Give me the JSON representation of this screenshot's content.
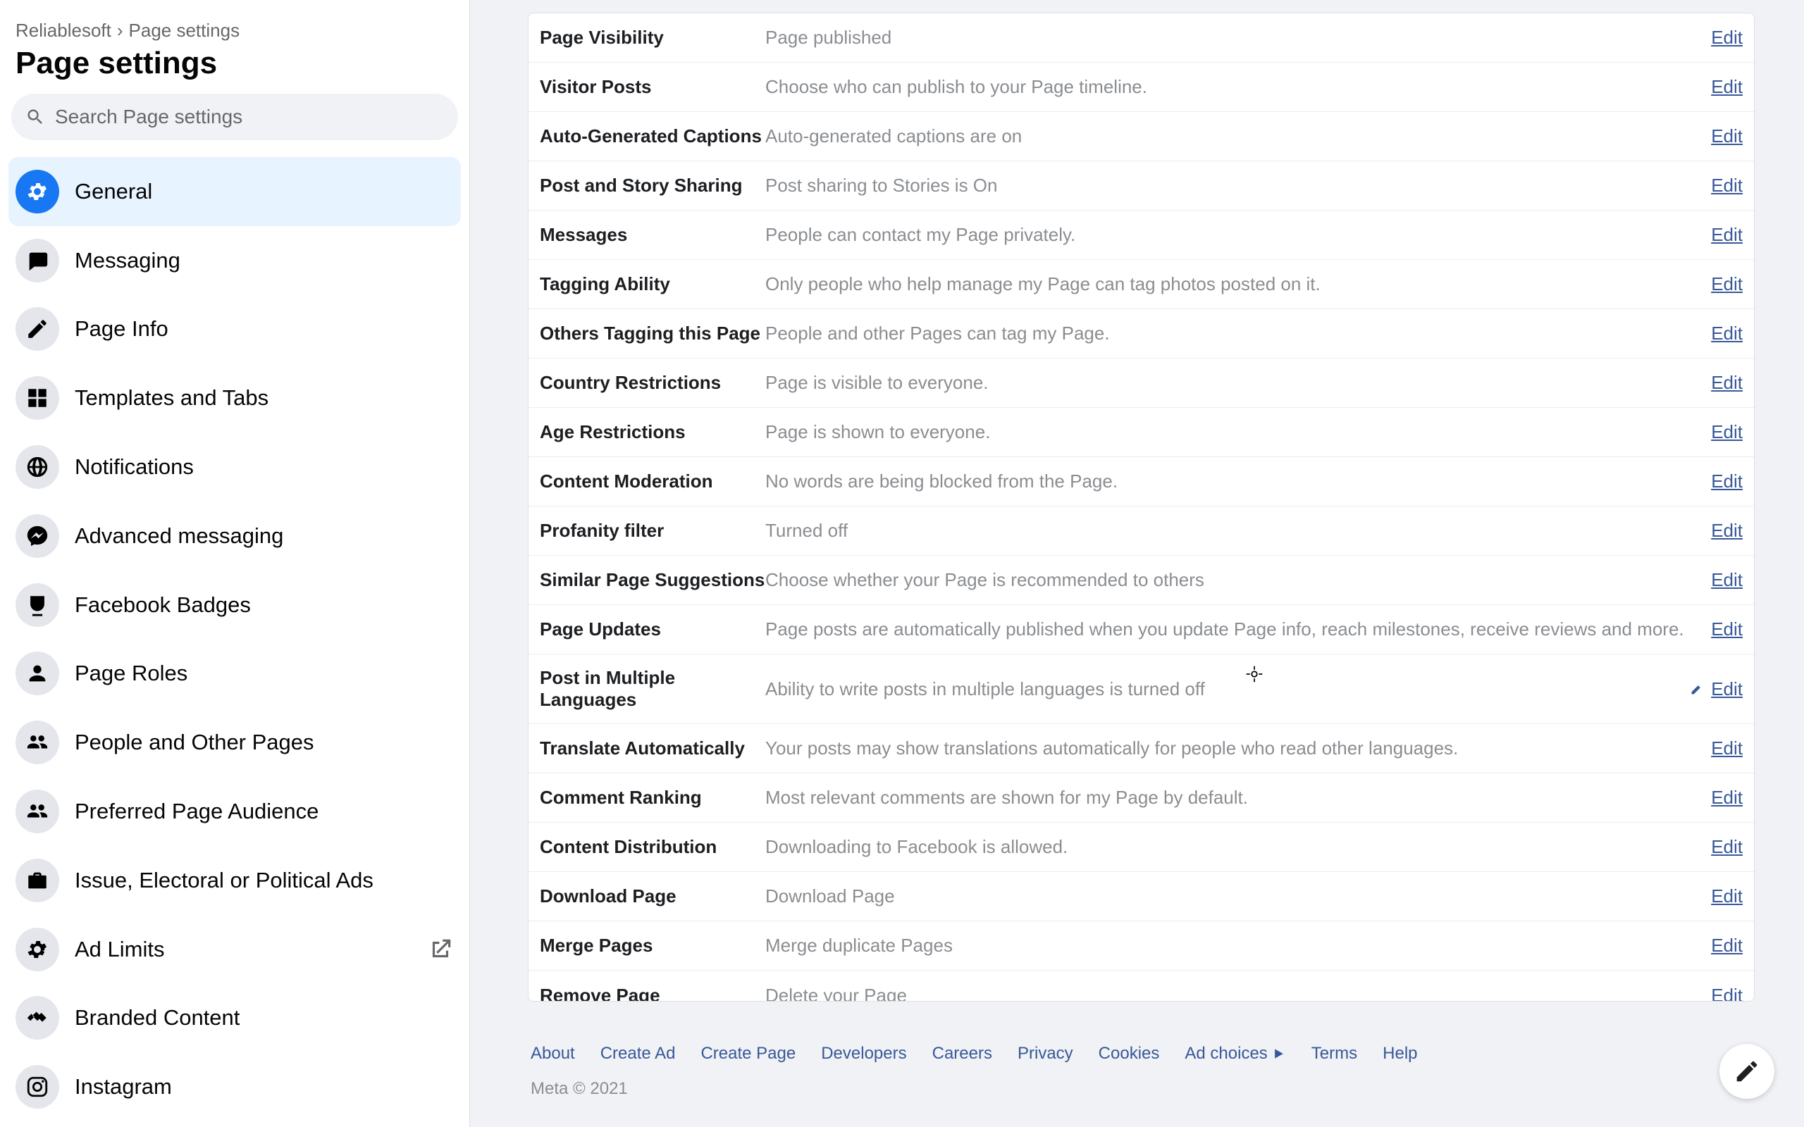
{
  "breadcrumb": {
    "parent": "Reliablesoft",
    "separator": "›",
    "current": "Page settings"
  },
  "page_title": "Page settings",
  "search": {
    "placeholder": "Search Page settings"
  },
  "sidebar": {
    "items": [
      {
        "key": "general",
        "label": "General",
        "icon": "gear-icon",
        "active": true
      },
      {
        "key": "messaging",
        "label": "Messaging",
        "icon": "chat-icon"
      },
      {
        "key": "page-info",
        "label": "Page Info",
        "icon": "pencil-icon"
      },
      {
        "key": "templates",
        "label": "Templates and Tabs",
        "icon": "grid-icon"
      },
      {
        "key": "notifications",
        "label": "Notifications",
        "icon": "globe-icon"
      },
      {
        "key": "adv-messaging",
        "label": "Advanced messaging",
        "icon": "messenger-icon"
      },
      {
        "key": "badges",
        "label": "Facebook Badges",
        "icon": "badge-icon"
      },
      {
        "key": "page-roles",
        "label": "Page Roles",
        "icon": "person-icon"
      },
      {
        "key": "people-pages",
        "label": "People and Other Pages",
        "icon": "people-icon"
      },
      {
        "key": "pref-audience",
        "label": "Preferred Page Audience",
        "icon": "people-icon"
      },
      {
        "key": "political-ads",
        "label": "Issue, Electoral or Political Ads",
        "icon": "briefcase-icon"
      },
      {
        "key": "ad-limits",
        "label": "Ad Limits",
        "icon": "gear-icon",
        "external": true
      },
      {
        "key": "branded",
        "label": "Branded Content",
        "icon": "handshake-icon"
      },
      {
        "key": "instagram",
        "label": "Instagram",
        "icon": "instagram-icon"
      }
    ]
  },
  "settings": [
    {
      "key": "page-visibility",
      "label": "Page Visibility",
      "value": "Page published",
      "edit": "Edit"
    },
    {
      "key": "visitor-posts",
      "label": "Visitor Posts",
      "value": "Choose who can publish to your Page timeline.",
      "edit": "Edit"
    },
    {
      "key": "captions",
      "label": "Auto-Generated Captions",
      "value": "Auto-generated captions are on",
      "edit": "Edit"
    },
    {
      "key": "post-story-sharing",
      "label": "Post and Story Sharing",
      "value": "Post sharing to Stories is On",
      "edit": "Edit"
    },
    {
      "key": "messages",
      "label": "Messages",
      "value": "People can contact my Page privately.",
      "edit": "Edit"
    },
    {
      "key": "tagging",
      "label": "Tagging Ability",
      "value": "Only people who help manage my Page can tag photos posted on it.",
      "edit": "Edit"
    },
    {
      "key": "others-tagging",
      "label": "Others Tagging this Page",
      "value": "People and other Pages can tag my Page.",
      "edit": "Edit"
    },
    {
      "key": "country",
      "label": "Country Restrictions",
      "value": "Page is visible to everyone.",
      "edit": "Edit"
    },
    {
      "key": "age",
      "label": "Age Restrictions",
      "value": "Page is shown to everyone.",
      "edit": "Edit"
    },
    {
      "key": "moderation",
      "label": "Content Moderation",
      "value": "No words are being blocked from the Page.",
      "edit": "Edit"
    },
    {
      "key": "profanity",
      "label": "Profanity filter",
      "value": "Turned off",
      "edit": "Edit"
    },
    {
      "key": "similar",
      "label": "Similar Page Suggestions",
      "value": "Choose whether your Page is recommended to others",
      "edit": "Edit"
    },
    {
      "key": "updates",
      "label": "Page Updates",
      "value": "Page posts are automatically published when you update Page info, reach milestones, receive reviews and more.",
      "edit": "Edit"
    },
    {
      "key": "multi-lang",
      "label": "Post in Multiple Languages",
      "value": "Ability to write posts in multiple languages is turned off",
      "edit": "Edit",
      "hovered": true
    },
    {
      "key": "translate",
      "label": "Translate Automatically",
      "value": "Your posts may show translations automatically for people who read other languages.",
      "edit": "Edit"
    },
    {
      "key": "comment-rank",
      "label": "Comment Ranking",
      "value": "Most relevant comments are shown for my Page by default.",
      "edit": "Edit"
    },
    {
      "key": "content-dist",
      "label": "Content Distribution",
      "value": "Downloading to Facebook is allowed.",
      "edit": "Edit"
    },
    {
      "key": "download",
      "label": "Download Page",
      "value": "Download Page",
      "edit": "Edit"
    },
    {
      "key": "merge",
      "label": "Merge Pages",
      "value": "Merge duplicate Pages",
      "edit": "Edit"
    },
    {
      "key": "remove",
      "label": "Remove Page",
      "value": "Delete your Page",
      "edit": "Edit"
    }
  ],
  "footer": {
    "links": [
      {
        "label": "About"
      },
      {
        "label": "Create Ad"
      },
      {
        "label": "Create Page"
      },
      {
        "label": "Developers"
      },
      {
        "label": "Careers"
      },
      {
        "label": "Privacy"
      },
      {
        "label": "Cookies"
      },
      {
        "label": "Ad choices",
        "icon": "adchoices-icon"
      },
      {
        "label": "Terms"
      },
      {
        "label": "Help"
      }
    ],
    "copyright": "Meta © 2021"
  }
}
